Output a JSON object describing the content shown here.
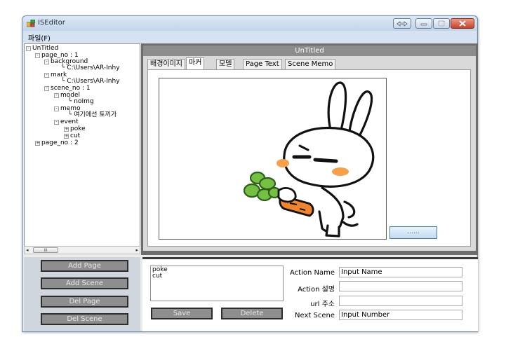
{
  "window": {
    "title": "ISEditor",
    "menu_file": "파일(F)"
  },
  "tree": {
    "items": [
      {
        "label": "UnTitled",
        "toggle": "-"
      },
      {
        "label": "page_no : 1",
        "toggle": "-"
      },
      {
        "label": "background",
        "toggle": "-"
      },
      {
        "label": "C:\\Users\\AR-Inhy",
        "toggle": ""
      },
      {
        "label": "mark",
        "toggle": "-"
      },
      {
        "label": "C:\\Users\\AR-Inhy",
        "toggle": ""
      },
      {
        "label": "scene_no : 1",
        "toggle": "-"
      },
      {
        "label": "model",
        "toggle": "-"
      },
      {
        "label": "noImg",
        "toggle": ""
      },
      {
        "label": "memo",
        "toggle": "-"
      },
      {
        "label": "여기에선 토끼가",
        "toggle": ""
      },
      {
        "label": "event",
        "toggle": "-"
      },
      {
        "label": "poke",
        "toggle": "+"
      },
      {
        "label": "cut",
        "toggle": "+"
      },
      {
        "label": "page_no : 2",
        "toggle": "+"
      }
    ],
    "scroll_thumb": "III"
  },
  "left_buttons": {
    "add_page": "Add Page",
    "add_scene": "Add Scene",
    "del_page": "Del Page",
    "del_scene": "Del Scene"
  },
  "scene_panel": {
    "title": "UnTitled",
    "tabs": [
      "배경이미지",
      "마커",
      "모델",
      "Page Text",
      "Scene Memo"
    ],
    "active_tab": "마커",
    "browse_button": "......"
  },
  "action_panel": {
    "actions": [
      "poke",
      "cut"
    ],
    "save_label": "Save",
    "delete_label": "Delete",
    "action_name_label": "Action Name",
    "action_name_value": "Input Name",
    "action_desc_label": "Action 설명",
    "action_desc_value": "",
    "url_label": "url 주소",
    "url_value": "",
    "next_scene_label": "Next Scene",
    "next_scene_value": "Input Number"
  }
}
